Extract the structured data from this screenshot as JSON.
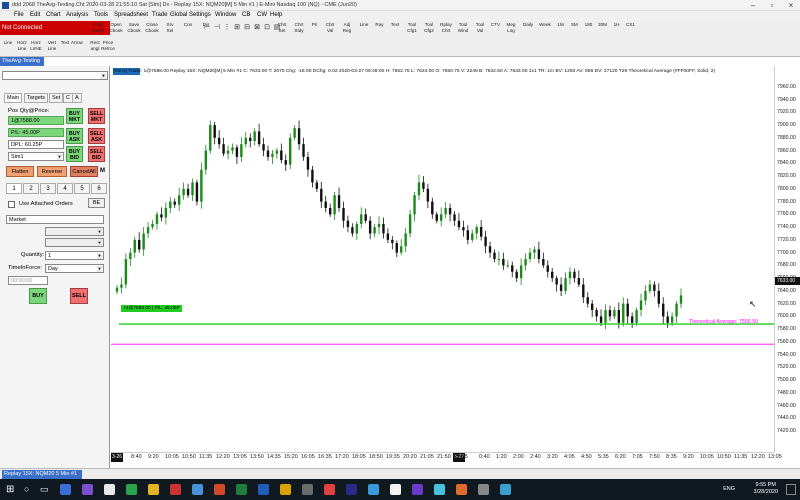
{
  "window": {
    "title": "ddd 2068 TheAvg-Testing.Cht  2020-03-28  21:55:10 Sat [Sim]  Dx  - Replay 15X: NQM20[M]  5 Min  #1 | E-Mini Nasdaq 100 (NQ) - CME (Jun20)"
  },
  "menu": [
    "File",
    "Edit",
    "Chart",
    "Analysis",
    "Tools",
    "Spreadsheet",
    "Trade",
    "Global Settings",
    "Window",
    "CB",
    "CW",
    "Help"
  ],
  "status": {
    "not_connected": "Not Connected"
  },
  "toolbar": {
    "row1": [
      {
        "label": "Find Symb"
      },
      {
        "label": "Open Cbook"
      },
      {
        "label": "Save Cbook"
      },
      {
        "label": "Close Cbook"
      },
      {
        "label": "Srv Sel"
      },
      {
        "label": "Con"
      },
      {
        "label": "Dis"
      }
    ],
    "row1b": [
      {
        "label": "Chrt Set"
      },
      {
        "label": "Chrt Stdy"
      },
      {
        "label": "Pri"
      },
      {
        "label": "Chrt Val"
      },
      {
        "label": "Adj Reg"
      },
      {
        "label": "Line"
      },
      {
        "label": "Ray"
      },
      {
        "label": "Text"
      },
      {
        "label": "Tool Cfg1"
      },
      {
        "label": "Tool Cfg2"
      },
      {
        "label": "Rplay Chrt"
      },
      {
        "label": "Tool Wind"
      },
      {
        "label": "Tool Val"
      },
      {
        "label": "CTV"
      },
      {
        "label": "Meg Log"
      },
      {
        "label": "Daily"
      },
      {
        "label": "Week"
      },
      {
        "label": "1M"
      },
      {
        "label": "5M"
      },
      {
        "label": "180"
      },
      {
        "label": "30M"
      },
      {
        "label": "1H"
      },
      {
        "label": "CS1"
      }
    ],
    "row2": [
      {
        "label": "Line"
      },
      {
        "label": "Horz Line"
      },
      {
        "label": "Horz LnNE"
      },
      {
        "label": "Vert Line"
      },
      {
        "label": "Text"
      },
      {
        "label": "Arrow"
      },
      {
        "label": "Rect angl"
      },
      {
        "label": "Price Retrce"
      }
    ]
  },
  "chart_tab": "TheAvg-Testing",
  "left_panel": {
    "tabs": [
      "Main",
      "Targets",
      "Set",
      "C",
      "A"
    ],
    "pos_label": "Pos Qty@Price:",
    "pos_value": "1@7588.00",
    "pl_value": "P/L: 45.00P",
    "dpl_value": "DPL: 60.25P",
    "account": "Sim1",
    "buy_mkt": "BUY MKT",
    "sell_mkt": "SELL MKT",
    "buy_ask": "BUY ASK",
    "sell_ask": "SELL ASK",
    "buy_bid": "BUY BID",
    "sell_bid": "SELL BID",
    "flatten": "Flatten",
    "reverse": "Reverse",
    "cancel_all": "CancelAll",
    "m_label": "M",
    "qty_tabs": [
      "1",
      "2",
      "3",
      "4",
      "5",
      "6"
    ],
    "use_attached": "Use Attached Orders",
    "be_label": "BE",
    "order_type": "Market",
    "quantity_label": "Quantity:",
    "quantity_value": "1",
    "tif_label": "TimeInForce:",
    "tif_value": "Day",
    "time_placeholder": "00:00:00",
    "buy": "BUY",
    "sell": "SELL"
  },
  "chart_header": "[Sim1] Trade: 1@7588.00  Replay 15X: NQM20[M]  5 Min  #1  C: 7633.00  T: 2070  Chg: -18.00  DChg: 0.02  2020-03-27 09:49:00  H: 7652.75  L: 7624.00  O: 7650.75  V: 2249  B: 7632.50  A: 7633.00  1x1 TR: 1m  BV: 1293  AV: 956  DV: 27120  T29 Theoretical Average  (#FF00FF, Solid, 2)",
  "annotations": {
    "position_line": "+1@7588.00 | P/L: 45.00P",
    "theoretical_avg": "Theoretical Average: 7556.50",
    "current_price": "7633.00"
  },
  "chart_data": {
    "type": "candlestick",
    "ylim": [
      7400,
      7980
    ],
    "price_ticks": [
      "7960.00",
      "7940.00",
      "7920.00",
      "7900.00",
      "7880.00",
      "7860.00",
      "7840.00",
      "7820.00",
      "7800.00",
      "7780.00",
      "7760.00",
      "7740.00",
      "7720.00",
      "7700.00",
      "7680.00",
      "7660.00",
      "7640.00",
      "7620.00",
      "7600.00",
      "7580.00",
      "7560.00",
      "7540.00",
      "7520.00",
      "7500.00",
      "7480.00",
      "7460.00",
      "7440.00",
      "7420.00"
    ],
    "time_ticks": [
      "8:40",
      "9:20",
      "10:05",
      "10:50",
      "11:35",
      "12:20",
      "13:05",
      "13:50",
      "14:35",
      "15:20",
      "16:05",
      "16:35",
      "17:20",
      "18:05",
      "18:50",
      "19:35",
      "20:20",
      "21:05",
      "21:50",
      "22:35",
      "0:40",
      "1:20",
      "2:00",
      "2:40",
      "3:20",
      "4:05",
      "4:50",
      "5:35",
      "6:20",
      "7:05",
      "7:50",
      "8:35",
      "9:20",
      "10:05",
      "10:50",
      "11:35",
      "12:20",
      "13:05"
    ],
    "date_markers": [
      "3-26",
      "3-27"
    ],
    "closes": [
      7645,
      7650,
      7690,
      7700,
      7720,
      7705,
      7730,
      7740,
      7745,
      7760,
      7755,
      7770,
      7780,
      7775,
      7790,
      7800,
      7790,
      7810,
      7780,
      7830,
      7860,
      7900,
      7880,
      7870,
      7855,
      7860,
      7865,
      7850,
      7870,
      7880,
      7875,
      7890,
      7870,
      7860,
      7850,
      7855,
      7860,
      7845,
      7838,
      7880,
      7895,
      7870,
      7850,
      7830,
      7810,
      7800,
      7780,
      7770,
      7760,
      7790,
      7770,
      7750,
      7740,
      7730,
      7745,
      7760,
      7750,
      7730,
      7740,
      7745,
      7730,
      7720,
      7715,
      7700,
      7710,
      7730,
      7760,
      7790,
      7810,
      7800,
      7780,
      7760,
      7750,
      7760,
      7770,
      7760,
      7750,
      7740,
      7735,
      7720,
      7730,
      7740,
      7725,
      7710,
      7700,
      7690,
      7690,
      7680,
      7680,
      7670,
      7660,
      7680,
      7690,
      7700,
      7705,
      7690,
      7680,
      7670,
      7660,
      7650,
      7640,
      7660,
      7670,
      7660,
      7650,
      7630,
      7620,
      7610,
      7600,
      7590,
      7610,
      7600,
      7610,
      7590,
      7620,
      7600,
      7590,
      7610,
      7625,
      7640,
      7650,
      7640,
      7620,
      7600,
      7590,
      7600,
      7620,
      7633
    ],
    "position_price": 7588.0,
    "theoretical_avg_price": 7556.5,
    "colors": {
      "up": "#1a8a1a",
      "down": "#111111",
      "position_line": "#22cc22",
      "theoretical_avg": "#ff00ff"
    }
  },
  "bottom_tab": "Replay 15X: NQM20  5 Min  #1",
  "taskbar": {
    "lang": "ENG",
    "time": "9:55 PM",
    "date": "3/28/2020",
    "icons": [
      {
        "color": "#3a6fd6"
      },
      {
        "color": "#7b4fcf"
      },
      {
        "color": "#e8e8e8"
      },
      {
        "color": "#2aa44a"
      },
      {
        "color": "#e6b422"
      },
      {
        "color": "#cc3333"
      },
      {
        "color": "#4a90d9"
      },
      {
        "color": "#d04a2a"
      },
      {
        "color": "#1e7e3e"
      },
      {
        "color": "#1f5fb8"
      },
      {
        "color": "#d9a400"
      },
      {
        "color": "#6b6b6b"
      },
      {
        "color": "#e04040"
      },
      {
        "color": "#2a2a8a"
      },
      {
        "color": "#3a9ad9"
      },
      {
        "color": "#f2f2f2"
      },
      {
        "color": "#6a3acb"
      },
      {
        "color": "#4ac0e0"
      },
      {
        "color": "#e06a2a"
      },
      {
        "color": "#888888"
      },
      {
        "color": "#3aa0d0"
      }
    ]
  }
}
